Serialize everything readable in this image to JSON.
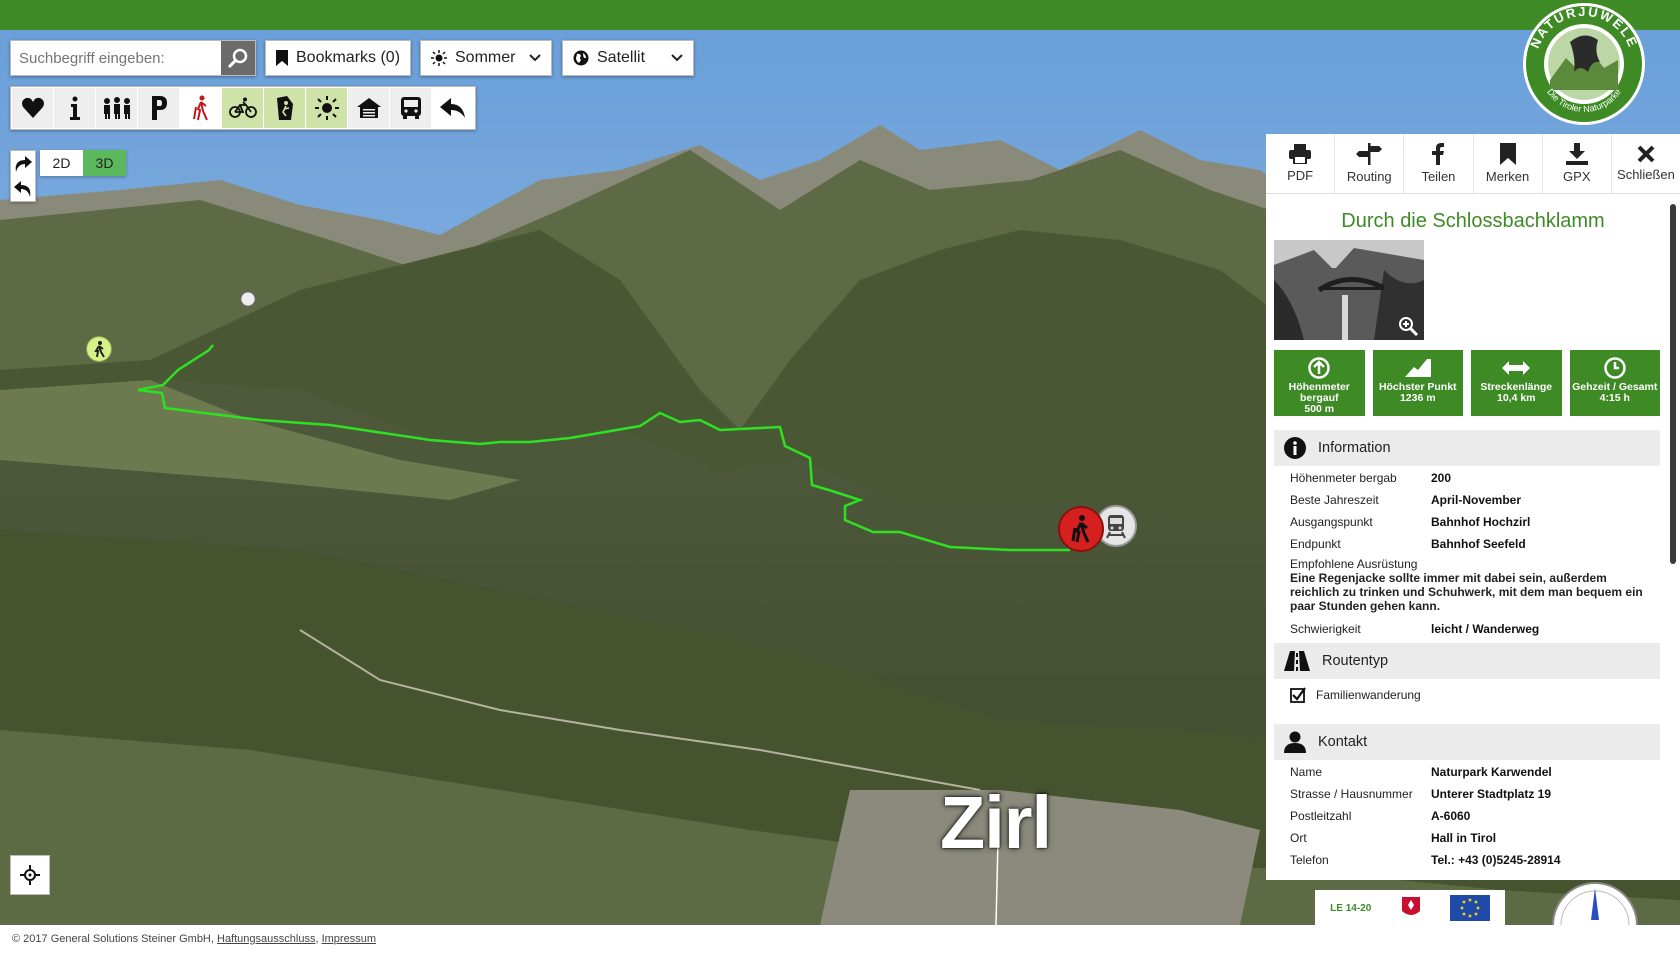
{
  "search": {
    "placeholder": "Suchbegriff eingeben:"
  },
  "bookmarks": {
    "label": "Bookmarks (0)"
  },
  "season": {
    "label": "Sommer"
  },
  "layer": {
    "label": "Satellit"
  },
  "toolbar": {
    "items": [
      "heart-icon",
      "info-icon",
      "group-icon",
      "parking-icon",
      "hiking-icon",
      "cycling-icon",
      "climbing-icon",
      "sun-icon",
      "hut-icon",
      "bus-icon",
      "back-arrow-icon"
    ]
  },
  "view": {
    "mode_2d": "2D",
    "mode_3d": "3D",
    "active": "3D"
  },
  "map": {
    "place_label": "Zirl"
  },
  "colors": {
    "brand_green": "#3e8a25",
    "route_line": "#2ee022",
    "marker_red": "#d62020"
  },
  "panel": {
    "actions": [
      {
        "label": "PDF",
        "icon": "printer-icon"
      },
      {
        "label": "Routing",
        "icon": "signpost-icon"
      },
      {
        "label": "Teilen",
        "icon": "facebook-icon"
      },
      {
        "label": "Merken",
        "icon": "bookmark-icon"
      },
      {
        "label": "GPX",
        "icon": "download-icon"
      },
      {
        "label": "Schließen",
        "icon": "close-icon"
      }
    ],
    "title": "Durch die Schlossbachklamm",
    "stats": [
      {
        "label": "Höhenmeter bergauf",
        "value": "500 m",
        "icon": "arrow-up-circle-icon"
      },
      {
        "label": "Höchster Punkt",
        "value": "1236 m",
        "icon": "peak-icon"
      },
      {
        "label": "Streckenlänge",
        "value": "10,4 km",
        "icon": "double-arrow-icon"
      },
      {
        "label": "Gehzeit / Gesamt",
        "value": "4:15 h",
        "icon": "clock-icon"
      }
    ],
    "information": {
      "heading": "Information",
      "rows": [
        {
          "k": "Höhenmeter bergab",
          "v": "200"
        },
        {
          "k": "Beste Jahreszeit",
          "v": "April-November"
        },
        {
          "k": "Ausgangspunkt",
          "v": "Bahnhof Hochzirl"
        },
        {
          "k": "Endpunkt",
          "v": "Bahnhof Seefeld"
        }
      ],
      "equipment_label": "Empfohlene Ausrüstung",
      "equipment_text": "Eine Regenjacke sollte immer mit dabei sein, außerdem reichlich zu trinken und Schuhwerk, mit dem man bequem ein paar Stunden gehen kann.",
      "difficulty_label": "Schwierigkeit",
      "difficulty_value": "leicht / Wanderweg"
    },
    "routetype": {
      "heading": "Routentyp",
      "item": "Familienwanderung",
      "checked": true
    },
    "contact": {
      "heading": "Kontakt",
      "rows": [
        {
          "k": "Name",
          "v": "Naturpark Karwendel"
        },
        {
          "k": "Strasse / Hausnummer",
          "v": "Unterer Stadtplatz 19"
        },
        {
          "k": "Postleitzahl",
          "v": "A-6060"
        },
        {
          "k": "Ort",
          "v": "Hall in Tirol"
        },
        {
          "k": "Telefon",
          "v": "Tel.: +43 (0)5245-28914"
        }
      ]
    }
  },
  "logo": {
    "top_text": "NATURJUWELE",
    "bottom_text": "Die Tiroler Naturparke"
  },
  "sponsors": {
    "le": "LE 14-20"
  },
  "footer": {
    "copyright": "© 2017 General Solutions Steiner GmbH,",
    "disclaimer": "Haftungsausschluss",
    "separator": ",",
    "imprint": "Impressum"
  }
}
